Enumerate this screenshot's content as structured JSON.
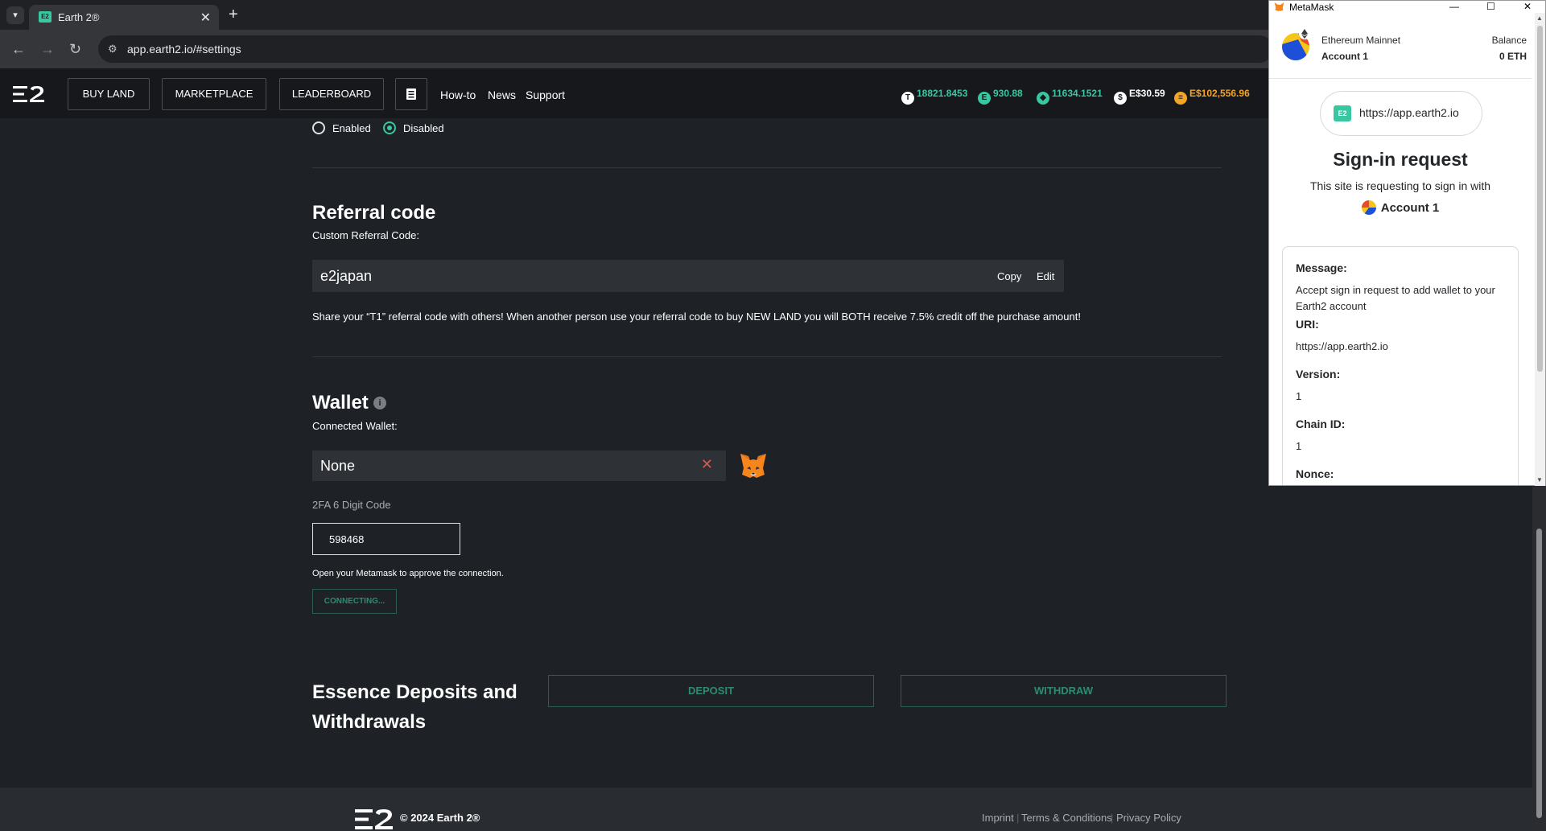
{
  "browser": {
    "tab_title": "Earth 2®",
    "url": "app.earth2.io/#settings"
  },
  "header": {
    "buy_land": "BUY LAND",
    "marketplace": "MARKETPLACE",
    "leaderboard": "LEADERBOARD",
    "howto": "How-to",
    "news": "News",
    "support": "Support",
    "stats": [
      "18821.8453",
      "930.88",
      "11634.1521",
      "E$30.59",
      "E$102,556.96"
    ]
  },
  "settings": {
    "radio_enabled": "Enabled",
    "radio_disabled": "Disabled",
    "radio_selected": "Disabled",
    "referral_title": "Referral code",
    "referral_label": "Custom Referral Code:",
    "referral_value": "e2japan",
    "copy": "Copy",
    "edit": "Edit",
    "referral_note": "Share your “T1” referral code with others! When another person use your referral code to buy NEW LAND you will BOTH receive 7.5% credit off the purchase amount!",
    "wallet_title": "Wallet",
    "wallet_label": "Connected Wallet:",
    "wallet_value": "None",
    "twofa_label": "2FA 6 Digit Code",
    "twofa_value": "598468",
    "metamask_hint": "Open your Metamask to approve the connection.",
    "connecting": "CONNECTING...",
    "essence_title": "Essence Deposits and Withdrawals",
    "deposit": "DEPOSIT",
    "withdraw": "WITHDRAW"
  },
  "footer": {
    "copyright": "© 2024 Earth 2®",
    "imprint": "Imprint",
    "terms": "Terms & Conditions",
    "privacy": "Privacy Policy"
  },
  "metamask": {
    "window_title": "MetaMask",
    "network": "Ethereum Mainnet",
    "account": "Account 1",
    "balance_label": "Balance",
    "balance": "0 ETH",
    "origin": "https://app.earth2.io",
    "heading": "Sign-in request",
    "description": "This site is requesting to sign in with",
    "account_row": "Account 1",
    "message_label": "Message:",
    "message_value": "Accept sign in request to add wallet to your Earth2 account",
    "uri_label": "URI:",
    "uri_value": "https://app.earth2.io",
    "version_label": "Version:",
    "version_value": "1",
    "chain_label": "Chain ID:",
    "chain_value": "1",
    "nonce_label": "Nonce:"
  },
  "colors": {
    "accent": "#37c7a1",
    "background": "#1e2126",
    "header": "#16181c",
    "danger": "#e2554d"
  }
}
